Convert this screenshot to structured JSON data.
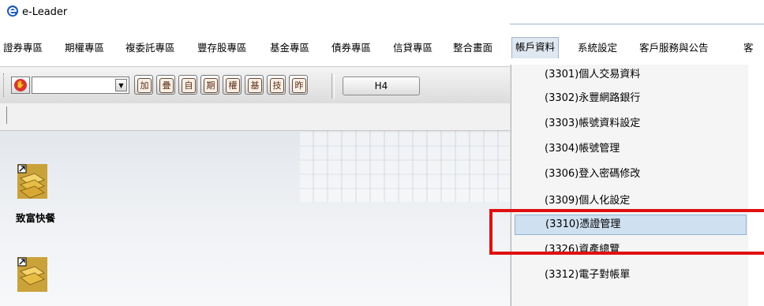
{
  "window": {
    "title": "e-Leader"
  },
  "menubar": [
    {
      "label": "證券專區",
      "x": 0
    },
    {
      "label": "期權專區",
      "x": 0
    },
    {
      "label": "複委託專區",
      "x": 0
    },
    {
      "label": "豐存股專區",
      "x": 0
    },
    {
      "label": "基金專區",
      "x": 0
    },
    {
      "label": "債券專區",
      "x": 0
    },
    {
      "label": "信貸專區",
      "x": 0
    },
    {
      "label": "整合畫面",
      "x": 0
    },
    {
      "label": "帳戶資料",
      "x": 0
    },
    {
      "label": "系統設定",
      "x": 0
    },
    {
      "label": "客戶服務與公告",
      "x": 0
    },
    {
      "label": "客",
      "x": 0
    }
  ],
  "toolbar": {
    "stop_label": "STOP",
    "combo_value": "",
    "buttons": [
      "加",
      "疊",
      "自",
      "期",
      "權",
      "基",
      "技",
      "昨"
    ],
    "h4_label": "H4"
  },
  "desktop": {
    "shortcuts": [
      {
        "label": "致富快餐"
      },
      {
        "label": ""
      }
    ]
  },
  "account_menu": {
    "items": [
      {
        "label": "(3301)個人交易資料"
      },
      {
        "label": "(3302)永豐網路銀行"
      },
      {
        "label": "(3303)帳號資料設定"
      },
      {
        "label": "(3304)帳號管理"
      },
      {
        "label": "(3306)登入密碼修改"
      },
      {
        "label": "(3309)個人化設定"
      },
      {
        "label": "(3310)憑證管理"
      },
      {
        "label": "(3326)資產總覽"
      },
      {
        "label": "(3312)電子對帳單"
      }
    ],
    "highlighted_index": 6
  },
  "colors": {
    "highlight": "#cfe0f0",
    "annotation_box": "#e01010",
    "title_accent": "#1a57b8"
  }
}
